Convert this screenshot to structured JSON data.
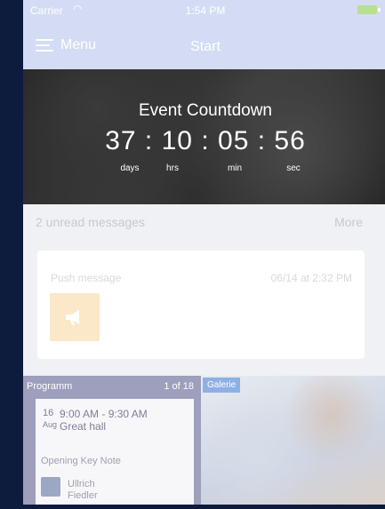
{
  "status_bar": {
    "carrier": "Carrier",
    "time": "1:54 PM"
  },
  "nav": {
    "menu_label": "Menu",
    "title": "Start"
  },
  "countdown": {
    "title": "Event Countdown",
    "values": [
      "37",
      "10",
      "05",
      "56"
    ],
    "separator": ":",
    "units": [
      "days",
      "hrs",
      "min",
      "sec"
    ]
  },
  "messages": {
    "unread_label": "2 unread messages",
    "more_label": "More",
    "card": {
      "type": "Push message",
      "date": "06/14 at 2:32 PM",
      "icon": "megaphone-icon"
    }
  },
  "programm": {
    "label": "Programm",
    "count": "1 of 18",
    "item": {
      "day": "16",
      "month": "Aug",
      "time": "9:00 AM - 9:30 AM",
      "location": "Great hall",
      "title": "Opening Key Note",
      "speaker_first": "Ullrich",
      "speaker_last": "Fiedler"
    }
  },
  "gallery": {
    "label": "Galerie"
  },
  "colors": {
    "nav_bg": "#d3dcf4",
    "accent": "#8fb0e6",
    "card_icon_bg": "#fbe8c8"
  }
}
